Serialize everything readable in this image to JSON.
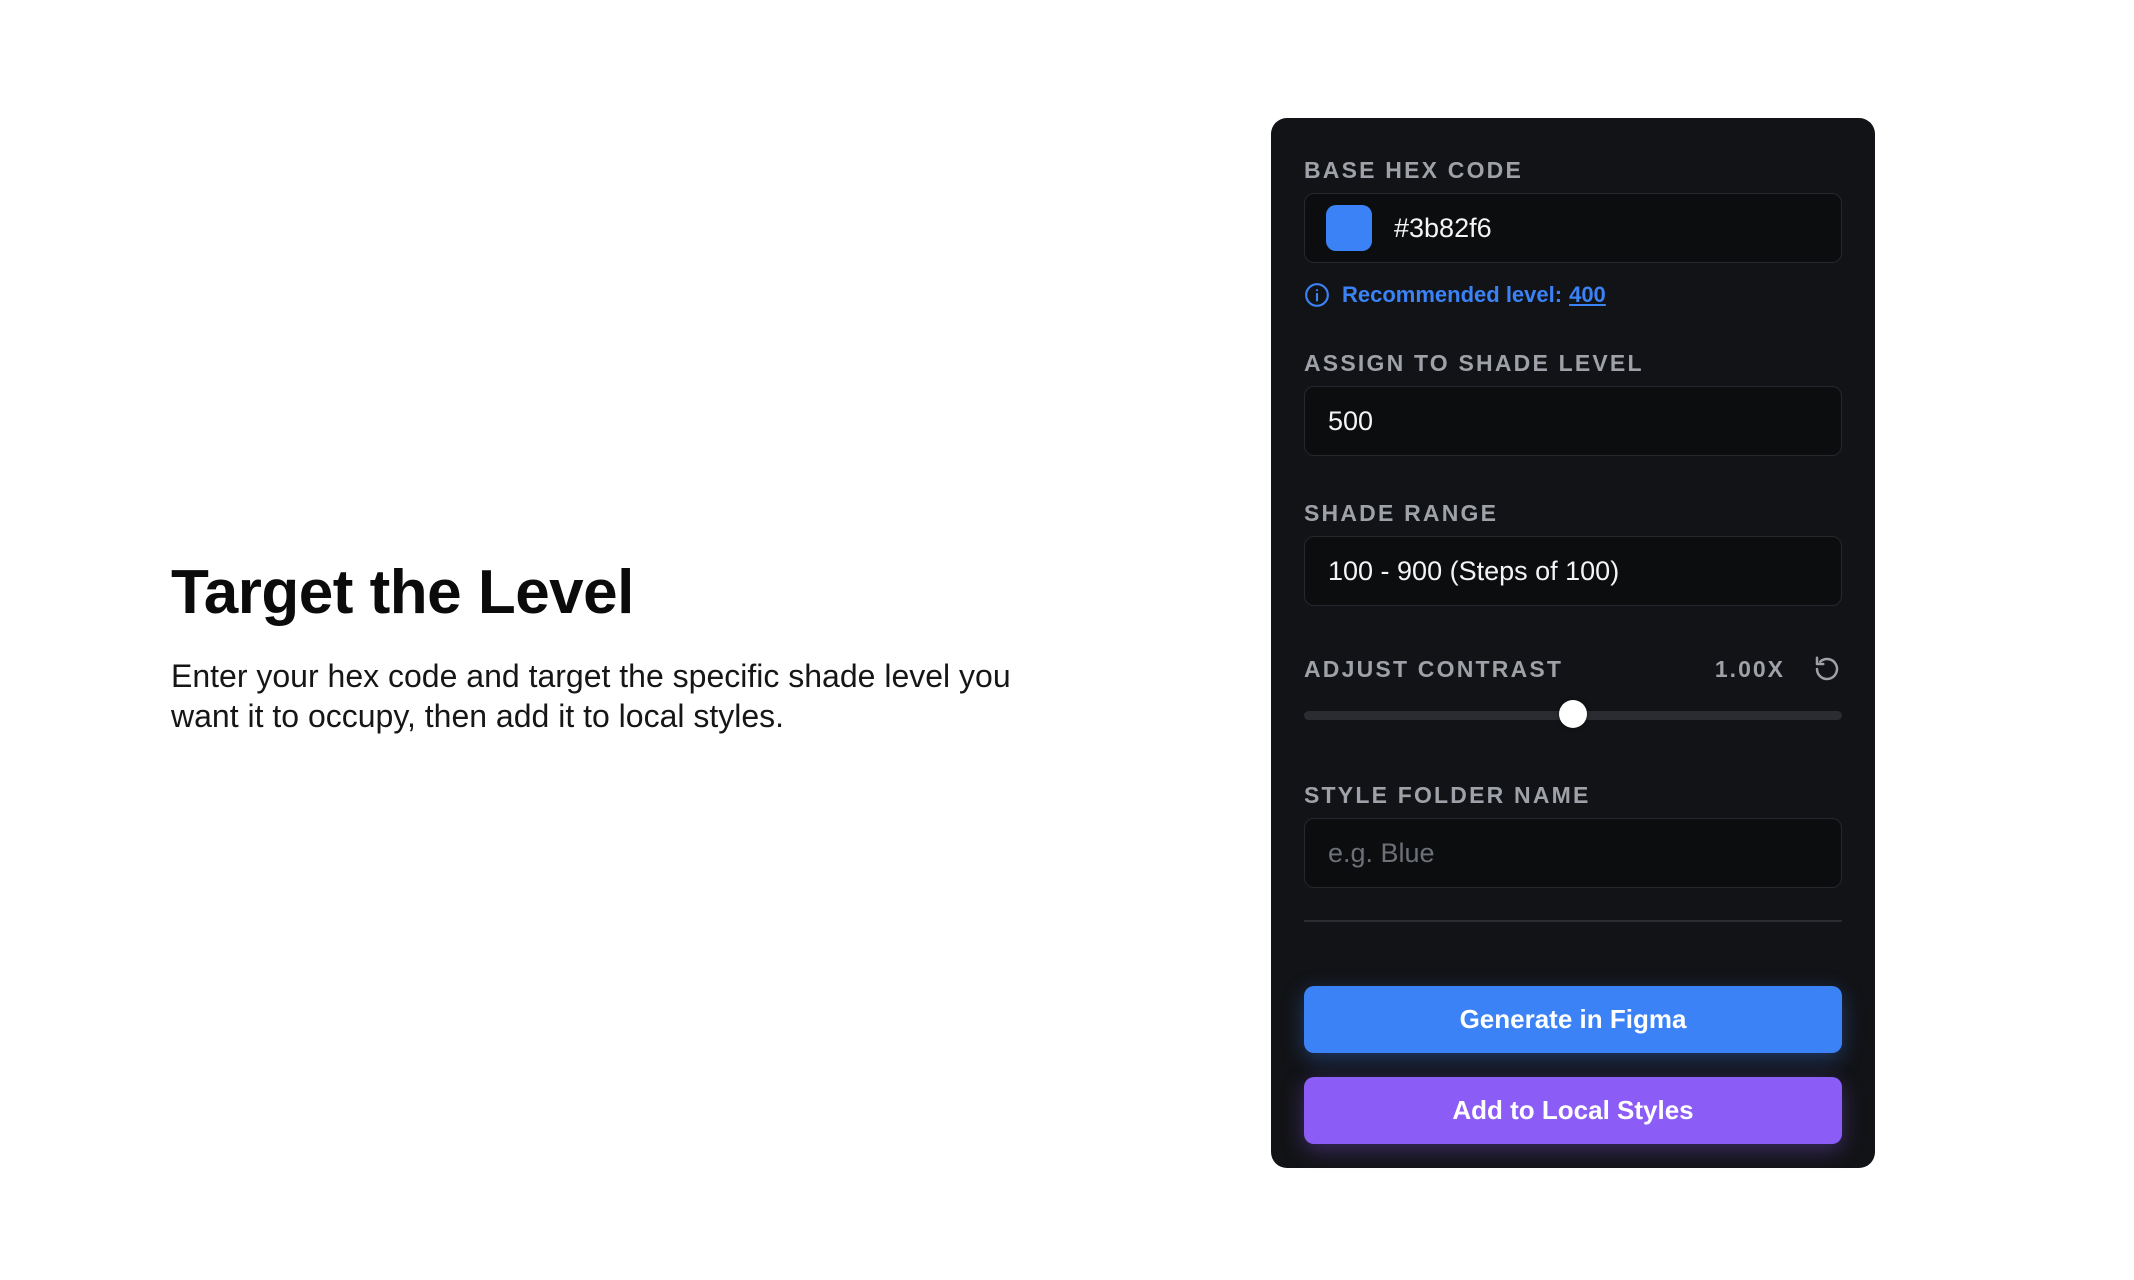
{
  "intro": {
    "title": "Target the Level",
    "description": "Enter your hex code and target the specific shade level you want it to occupy, then add it to local styles."
  },
  "panel": {
    "base_hex": {
      "label": "BASE HEX CODE",
      "value": "#3b82f6",
      "swatch_color": "#3b82f6"
    },
    "recommendation": {
      "icon": "info-icon",
      "text": "Recommended level:",
      "level": "400"
    },
    "shade_level": {
      "label": "ASSIGN TO SHADE LEVEL",
      "value": "500"
    },
    "shade_range": {
      "label": "SHADE RANGE",
      "value": "100 - 900 (Steps of 100)"
    },
    "contrast": {
      "label": "ADJUST CONTRAST",
      "value": "1.00X",
      "reset_icon": "reset-icon",
      "slider_position": 0.5
    },
    "folder_name": {
      "label": "STYLE FOLDER NAME",
      "placeholder": "e.g. Blue",
      "value": ""
    },
    "buttons": {
      "generate": "Generate in Figma",
      "add_local": "Add to Local Styles"
    }
  },
  "colors": {
    "panel_bg": "#121316",
    "accent_blue": "#3b82f6",
    "accent_purple": "#8b5cf6"
  }
}
